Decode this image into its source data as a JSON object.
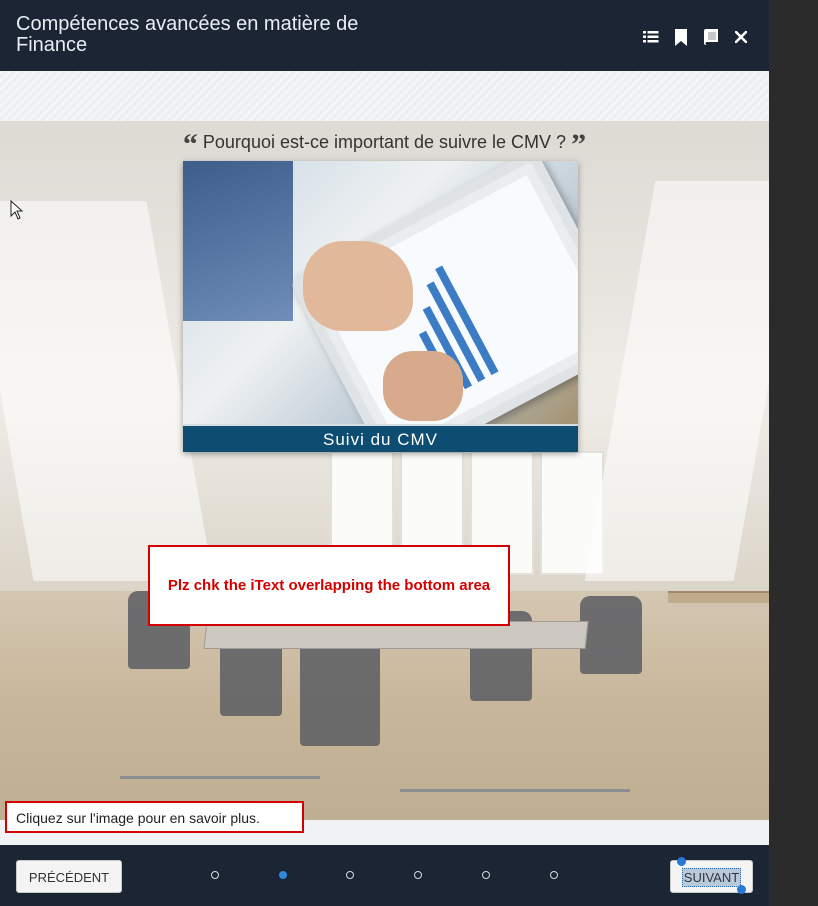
{
  "header": {
    "title": "Compétences avancées en matière de Finance",
    "tools": [
      {
        "name": "menu-list-icon"
      },
      {
        "name": "bookmark-icon"
      },
      {
        "name": "book-icon"
      },
      {
        "name": "close-icon"
      }
    ]
  },
  "slide": {
    "question": "Pourquoi est-ce important de suivre le CMV ?",
    "card_caption": "Suivi du CMV",
    "review_note": "Plz chk the iText overlapping the bottom area",
    "instruction": "Cliquez sur l'image pour en savoir plus."
  },
  "footer": {
    "prev_label": "PRÉCÉDENT",
    "next_label": "SUIVANT",
    "total_pages": 6,
    "active_page": 2
  },
  "colors": {
    "header_bg": "#1c2533",
    "caption_bg": "#0e4d72",
    "annotation": "#d40000",
    "dot_active": "#2d8ae0"
  }
}
